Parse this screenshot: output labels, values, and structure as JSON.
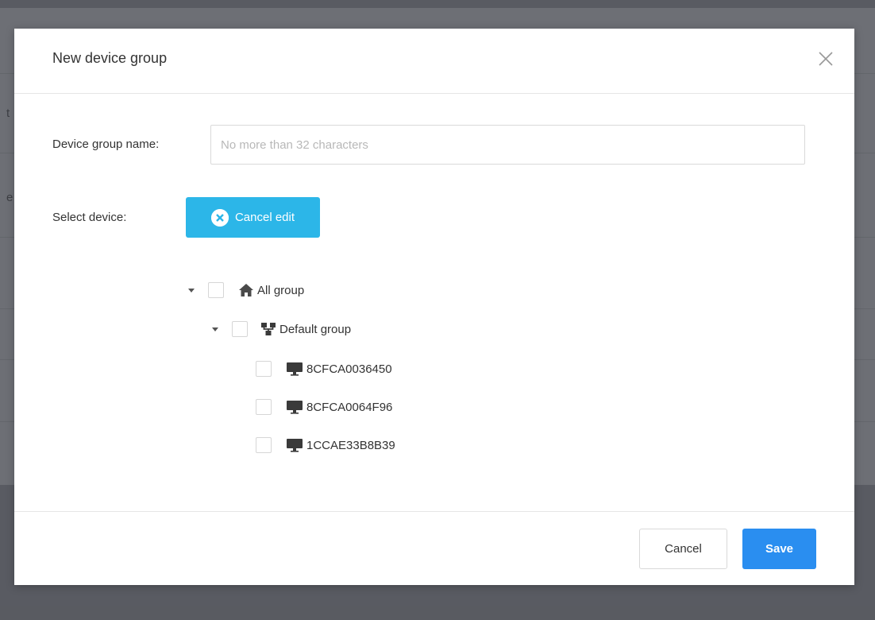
{
  "background": {
    "fragments": [
      "t",
      "e"
    ]
  },
  "dialog": {
    "title": "New device group",
    "name_label": "Device group name:",
    "name_placeholder": "No more than 32 characters",
    "name_value": "",
    "select_label": "Select device:",
    "cancel_edit_label": "Cancel edit"
  },
  "tree": {
    "root": {
      "label": "All group",
      "icon": "home-icon",
      "expanded": true,
      "checked": false
    },
    "group": {
      "label": "Default group",
      "icon": "sitemap-icon",
      "expanded": true,
      "checked": false
    },
    "devices": [
      {
        "label": "8CFCA0036450",
        "icon": "monitor-icon",
        "checked": false
      },
      {
        "label": "8CFCA0064F96",
        "icon": "monitor-icon",
        "checked": false
      },
      {
        "label": "1CCAE33B8B39",
        "icon": "monitor-icon",
        "checked": false
      }
    ]
  },
  "footer": {
    "cancel_label": "Cancel",
    "save_label": "Save"
  },
  "colors": {
    "primary_button": "#2a8ef0",
    "cancel_edit_button": "#2cb6e8",
    "overlay": "#5f6268"
  }
}
